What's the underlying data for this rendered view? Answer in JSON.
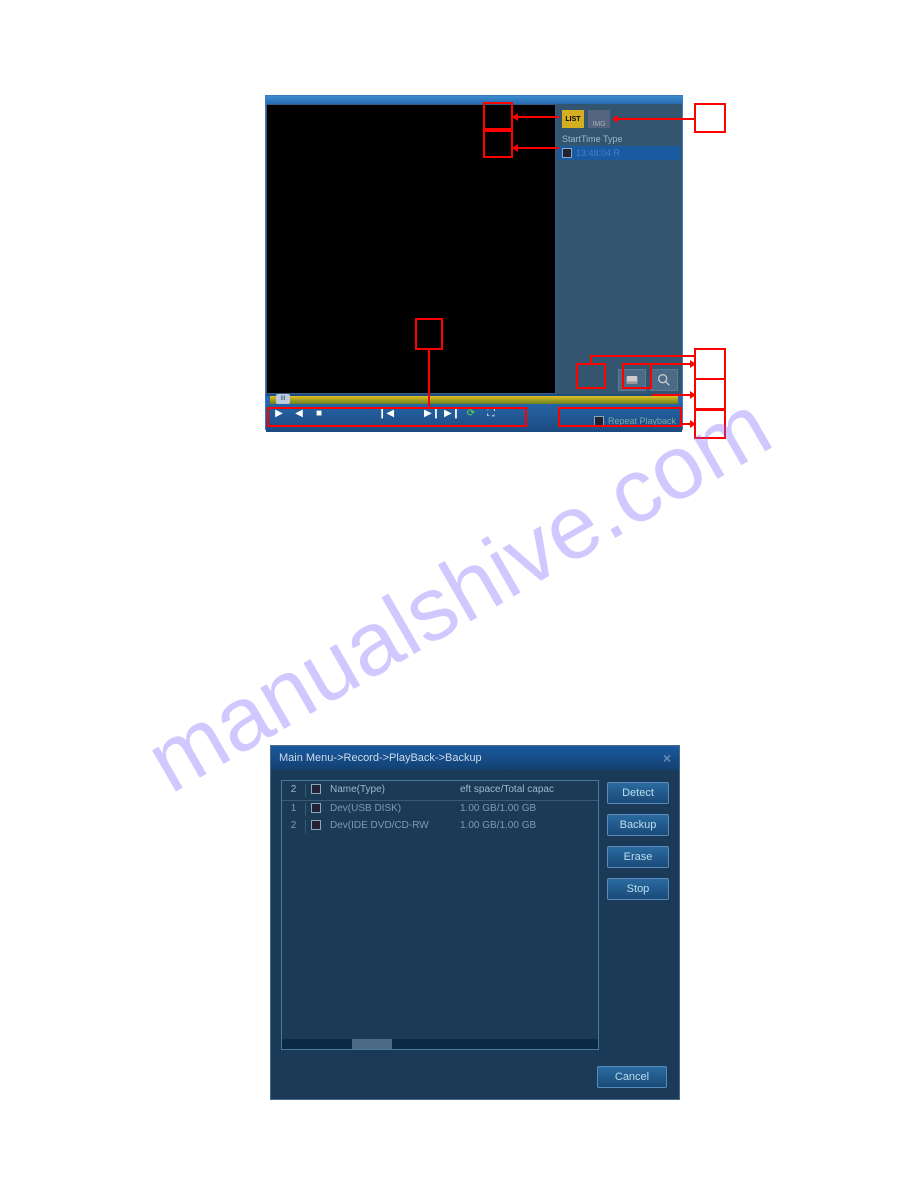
{
  "watermark": "manualshive.com",
  "playback": {
    "list_icon_label": "LIST",
    "img_icon_label": "IMG",
    "sidebar_header": "StartTime Type",
    "sidebar_row_time": "13:48:04  R",
    "timeline_handle": "III",
    "repeat_label": "Repeat Playback"
  },
  "backup": {
    "title": "Main Menu->Record->PlayBack->Backup",
    "header": {
      "count": "2",
      "name_col": "Name(Type)",
      "space_col": "eft space/Total capac"
    },
    "rows": [
      {
        "num": "1",
        "name": "Dev(USB DISK)",
        "space": "1.00 GB/1.00 GB"
      },
      {
        "num": "2",
        "name": "Dev(IDE DVD/CD-RW",
        "space": "1.00 GB/1.00 GB"
      }
    ],
    "buttons": {
      "detect": "Detect",
      "backup": "Backup",
      "erase": "Erase",
      "stop": "Stop",
      "cancel": "Cancel"
    }
  }
}
